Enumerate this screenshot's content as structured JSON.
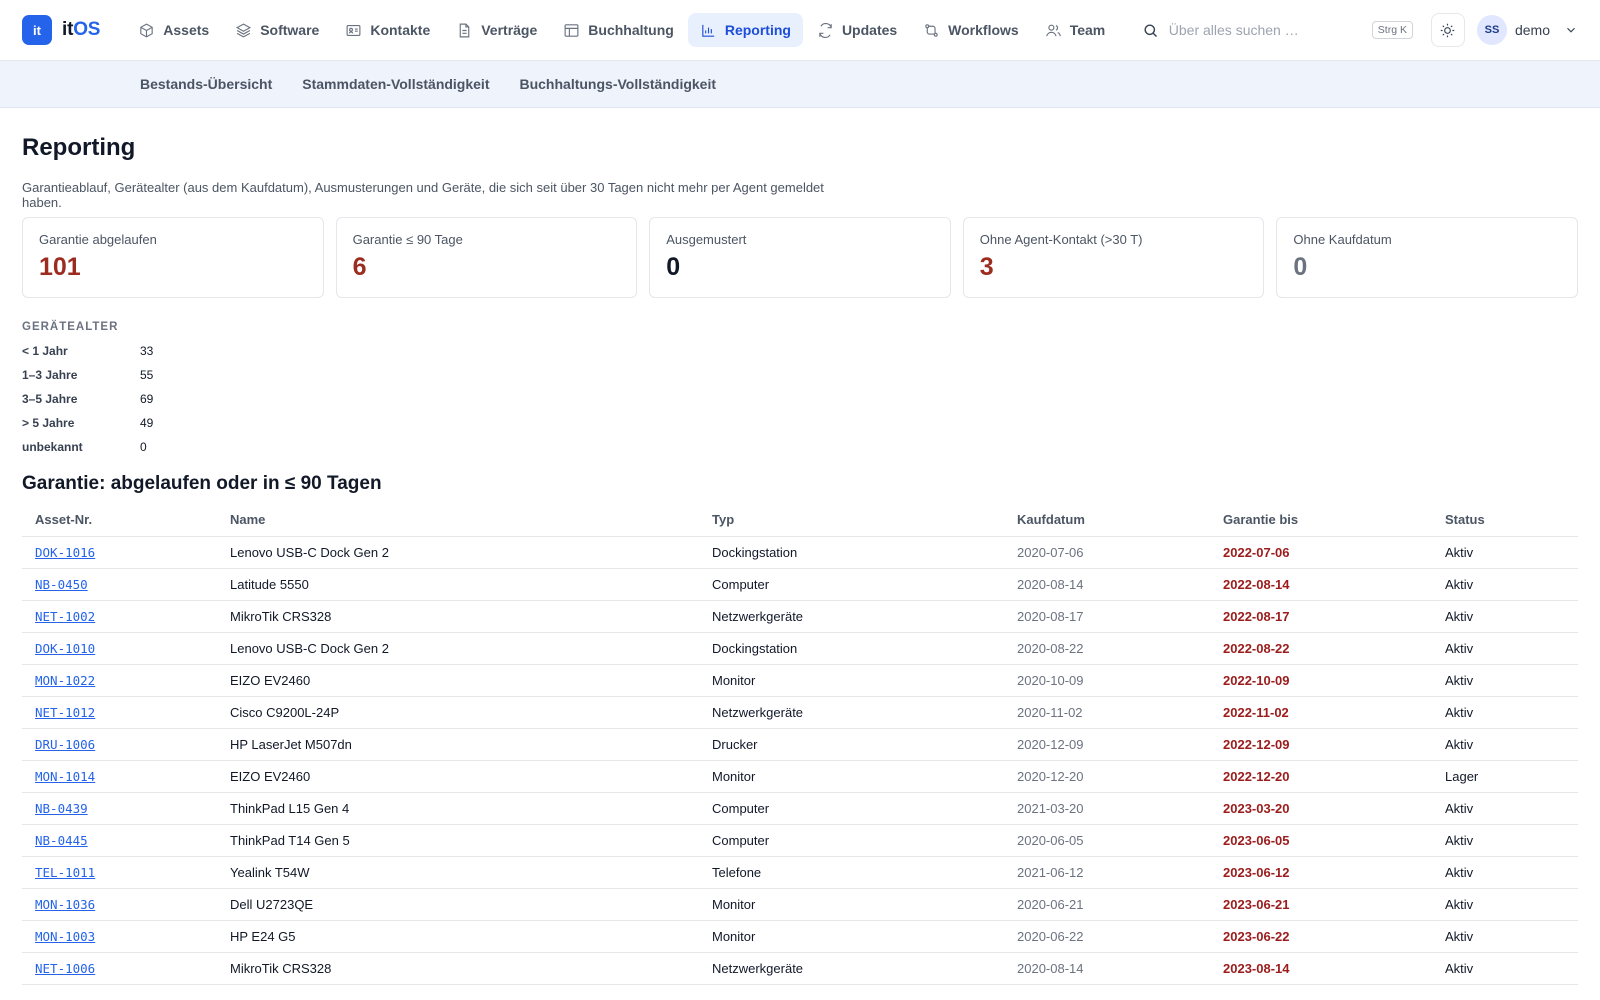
{
  "brand": {
    "badge": "it",
    "name_it": "it",
    "name_os": "OS"
  },
  "nav": [
    {
      "label": "Assets",
      "icon": "cube-icon",
      "active": false
    },
    {
      "label": "Software",
      "icon": "layers-icon",
      "active": false
    },
    {
      "label": "Kontakte",
      "icon": "contact-card-icon",
      "active": false
    },
    {
      "label": "Verträge",
      "icon": "document-icon",
      "active": false
    },
    {
      "label": "Buchhaltung",
      "icon": "ledger-table-icon",
      "active": false
    },
    {
      "label": "Reporting",
      "icon": "bar-chart-icon",
      "active": true
    },
    {
      "label": "Updates",
      "icon": "refresh-icon",
      "active": false
    },
    {
      "label": "Workflows",
      "icon": "workflow-icon",
      "active": false
    },
    {
      "label": "Team",
      "icon": "users-icon",
      "active": false
    }
  ],
  "search": {
    "placeholder": "Über alles suchen …",
    "shortcut": "Strg K"
  },
  "user": {
    "initials": "SS",
    "name": "demo"
  },
  "subnav": [
    "Bestands-Übersicht",
    "Stammdaten-Vollständigkeit",
    "Buchhaltungs-Vollständigkeit"
  ],
  "page": {
    "title": "Reporting",
    "description": "Garantieablauf, Gerätealter (aus dem Kaufdatum), Ausmusterungen und Geräte, die sich seit über 30 Tagen nicht mehr per Agent gemeldet haben."
  },
  "cards": [
    {
      "label": "Garantie abgelaufen",
      "value": "101",
      "tone": "red"
    },
    {
      "label": "Garantie ≤ 90 Tage",
      "value": "6",
      "tone": "red"
    },
    {
      "label": "Ausgemustert",
      "value": "0",
      "tone": "dark"
    },
    {
      "label": "Ohne Agent-Kontakt (>30 T)",
      "value": "3",
      "tone": "red"
    },
    {
      "label": "Ohne Kaufdatum",
      "value": "0",
      "tone": "gray"
    }
  ],
  "age": {
    "title": "GERÄTEALTER",
    "rows": [
      {
        "label": "< 1 Jahr",
        "value": "33"
      },
      {
        "label": "1–3 Jahre",
        "value": "55"
      },
      {
        "label": "3–5 Jahre",
        "value": "69"
      },
      {
        "label": "> 5 Jahre",
        "value": "49"
      },
      {
        "label": "unbekannt",
        "value": "0"
      }
    ]
  },
  "warranty_table": {
    "title": "Garantie: abgelaufen oder in ≤ 90 Tagen",
    "columns": [
      "Asset-Nr.",
      "Name",
      "Typ",
      "Kaufdatum",
      "Garantie bis",
      "Status"
    ],
    "rows": [
      [
        "DOK-1016",
        "Lenovo USB-C Dock Gen 2",
        "Dockingstation",
        "2020-07-06",
        "2022-07-06",
        "Aktiv"
      ],
      [
        "NB-0450",
        "Latitude 5550",
        "Computer",
        "2020-08-14",
        "2022-08-14",
        "Aktiv"
      ],
      [
        "NET-1002",
        "MikroTik CRS328",
        "Netzwerkgeräte",
        "2020-08-17",
        "2022-08-17",
        "Aktiv"
      ],
      [
        "DOK-1010",
        "Lenovo USB-C Dock Gen 2",
        "Dockingstation",
        "2020-08-22",
        "2022-08-22",
        "Aktiv"
      ],
      [
        "MON-1022",
        "EIZO EV2460",
        "Monitor",
        "2020-10-09",
        "2022-10-09",
        "Aktiv"
      ],
      [
        "NET-1012",
        "Cisco C9200L-24P",
        "Netzwerkgeräte",
        "2020-11-02",
        "2022-11-02",
        "Aktiv"
      ],
      [
        "DRU-1006",
        "HP LaserJet M507dn",
        "Drucker",
        "2020-12-09",
        "2022-12-09",
        "Aktiv"
      ],
      [
        "MON-1014",
        "EIZO EV2460",
        "Monitor",
        "2020-12-20",
        "2022-12-20",
        "Lager"
      ],
      [
        "NB-0439",
        "ThinkPad L15 Gen 4",
        "Computer",
        "2021-03-20",
        "2023-03-20",
        "Aktiv"
      ],
      [
        "NB-0445",
        "ThinkPad T14 Gen 5",
        "Computer",
        "2020-06-05",
        "2023-06-05",
        "Aktiv"
      ],
      [
        "TEL-1011",
        "Yealink T54W",
        "Telefone",
        "2021-06-12",
        "2023-06-12",
        "Aktiv"
      ],
      [
        "MON-1036",
        "Dell U2723QE",
        "Monitor",
        "2020-06-21",
        "2023-06-21",
        "Aktiv"
      ],
      [
        "MON-1003",
        "HP E24 G5",
        "Monitor",
        "2020-06-22",
        "2023-06-22",
        "Aktiv"
      ],
      [
        "NET-1006",
        "MikroTik CRS328",
        "Netzwerkgeräte",
        "2020-08-14",
        "2023-08-14",
        "Aktiv"
      ]
    ]
  },
  "colors": {
    "accent": "#2563eb",
    "danger": "#9b2c1f",
    "subnav_bg": "#eef3fc"
  }
}
